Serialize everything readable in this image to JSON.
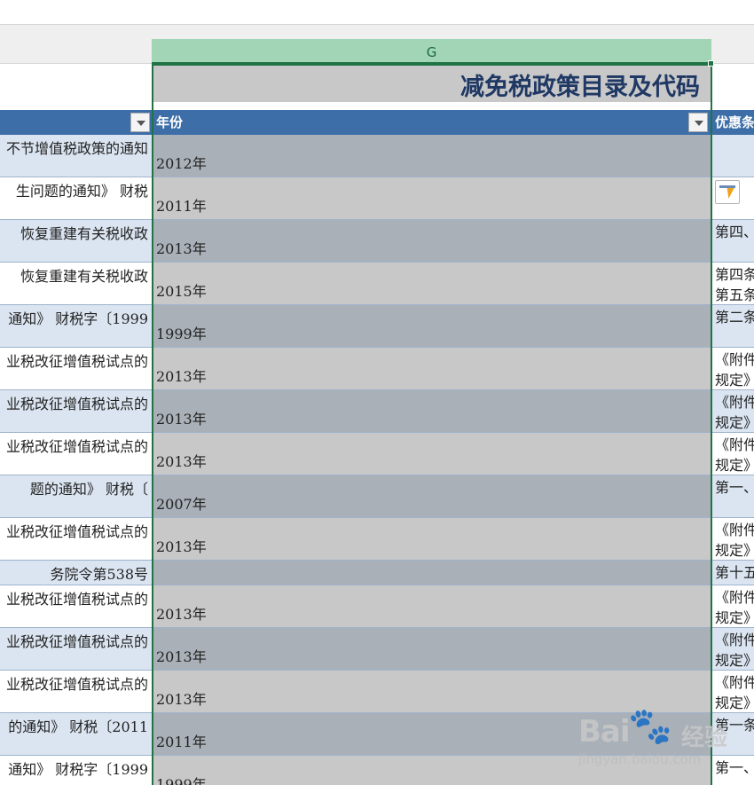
{
  "column_letter": "G",
  "title": "减免税政策目录及代码",
  "header": {
    "year": "年份",
    "right": "优惠条"
  },
  "rows": [
    {
      "left": "不节增值税政策的通知",
      "year": "2012年",
      "right": "",
      "shade": "dark",
      "band": "blue",
      "h": 48,
      "icon": false
    },
    {
      "left": "生问题的通知》 财税",
      "year": "2011年",
      "right": "",
      "shade": "light",
      "band": "white",
      "h": 48,
      "icon": true
    },
    {
      "left": "恢复重建有关税收政",
      "year": "2013年",
      "right": "第四、",
      "shade": "dark",
      "band": "blue",
      "h": 48,
      "icon": false
    },
    {
      "left": "恢复重建有关税收政",
      "year": "2015年",
      "right": "第四条\n第五条",
      "shade": "light",
      "band": "white",
      "h": 48,
      "icon": false
    },
    {
      "left": "通知》 财税字〔1999",
      "year": "1999年",
      "right": "第二条",
      "shade": "dark",
      "band": "blue",
      "h": 48,
      "icon": false
    },
    {
      "left": "业税改征增值税试点的",
      "year": "2013年",
      "right": "《附件\n规定》",
      "shade": "light",
      "band": "white",
      "h": 48,
      "icon": false
    },
    {
      "left": "业税改征增值税试点的",
      "year": "2013年",
      "right": "《附件\n规定》",
      "shade": "dark",
      "band": "blue",
      "h": 48,
      "icon": false
    },
    {
      "left": "业税改征增值税试点的",
      "year": "2013年",
      "right": "《附件\n规定》",
      "shade": "light",
      "band": "white",
      "h": 48,
      "icon": false
    },
    {
      "left": "题的通知》 财税〔",
      "year": "2007年",
      "right": "第一、",
      "shade": "dark",
      "band": "blue",
      "h": 48,
      "icon": false
    },
    {
      "left": "业税改征增值税试点的",
      "year": "2013年",
      "right": "《附件\n规定》",
      "shade": "light",
      "band": "white",
      "h": 48,
      "icon": false
    },
    {
      "left": "务院令第538号",
      "year": "",
      "right": "第十五",
      "shade": "dark",
      "band": "blue",
      "h": 28,
      "icon": false
    },
    {
      "left": "业税改征增值税试点的",
      "year": "2013年",
      "right": "《附件\n规定》",
      "shade": "light",
      "band": "white",
      "h": 48,
      "icon": false
    },
    {
      "left": "业税改征增值税试点的",
      "year": "2013年",
      "right": "《附件\n规定》",
      "shade": "dark",
      "band": "blue",
      "h": 48,
      "icon": false
    },
    {
      "left": "业税改征增值税试点的",
      "year": "2013年",
      "right": "《附件\n规定》",
      "shade": "light",
      "band": "white",
      "h": 48,
      "icon": false
    },
    {
      "left": "的通知》 财税〔2011",
      "year": "2011年",
      "right": "第一条",
      "shade": "dark",
      "band": "blue",
      "h": 48,
      "icon": false
    },
    {
      "left": "通知》 财税字〔1999",
      "year": "1999年",
      "right": "第一、",
      "shade": "light",
      "band": "white",
      "h": 48,
      "icon": false
    }
  ],
  "watermark": {
    "logo": "Bai",
    "suffix": "经验",
    "url": "jingyan.baidu.com"
  }
}
